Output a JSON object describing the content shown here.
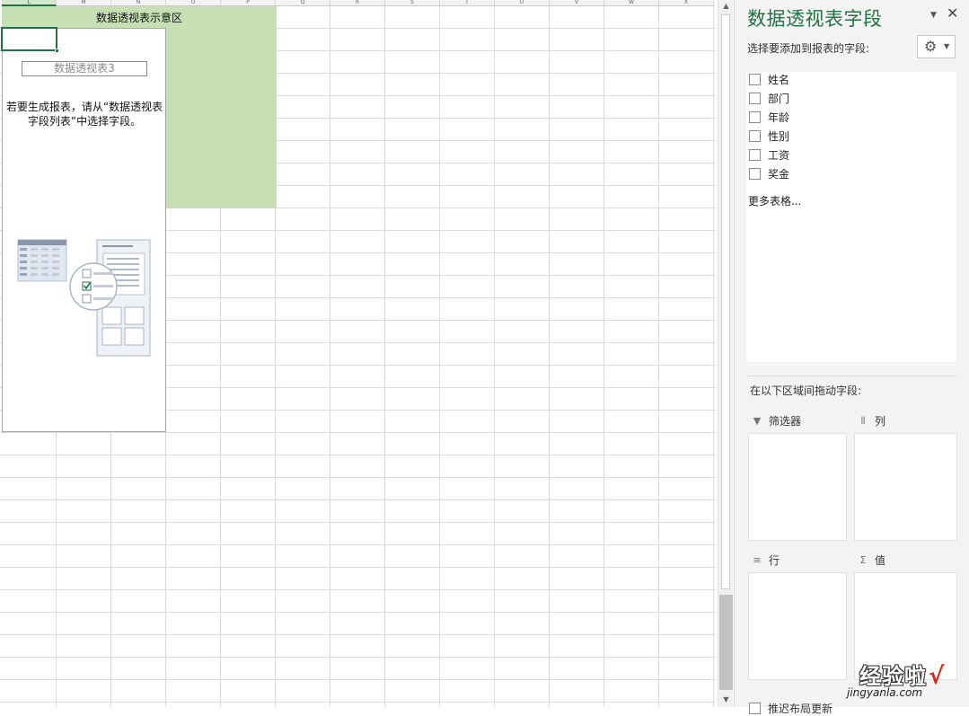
{
  "sheet": {
    "columns": [
      "L",
      "M",
      "N",
      "O",
      "P",
      "Q",
      "R",
      "S",
      "T",
      "U",
      "V",
      "W",
      "X"
    ],
    "selected_column": "L",
    "pivot_area_title": "数据透视表示意区",
    "pivot_name": "数据透视表3",
    "pivot_hint": "若要生成报表，请从“数据透视表字段列表”中选择字段。"
  },
  "panel": {
    "title": "数据透视表字段",
    "choose_fields_label": "选择要添加到报表的字段:",
    "fields": [
      {
        "label": "姓名",
        "checked": false
      },
      {
        "label": "部门",
        "checked": false
      },
      {
        "label": "年龄",
        "checked": false
      },
      {
        "label": "性别",
        "checked": false
      },
      {
        "label": "工资",
        "checked": false
      },
      {
        "label": "奖金",
        "checked": false
      }
    ],
    "more_tables": "更多表格...",
    "drag_label": "在以下区域间拖动字段:",
    "areas": {
      "filter": {
        "label": "筛选器",
        "icon": "filter-icon"
      },
      "columns": {
        "label": "列",
        "icon": "columns-icon"
      },
      "rows": {
        "label": "行",
        "icon": "rows-icon"
      },
      "values": {
        "label": "值",
        "icon": "sigma-icon"
      }
    },
    "defer_update_label": "推迟布局更新"
  },
  "watermark": {
    "text": "经验啦",
    "check": "√",
    "url": "jingyanla.com"
  },
  "colors": {
    "accent_green": "#217346",
    "pivot_area_fill": "#c6e0b4",
    "panel_bg": "#f3f3f3",
    "watermark_check": "#d9261c"
  }
}
